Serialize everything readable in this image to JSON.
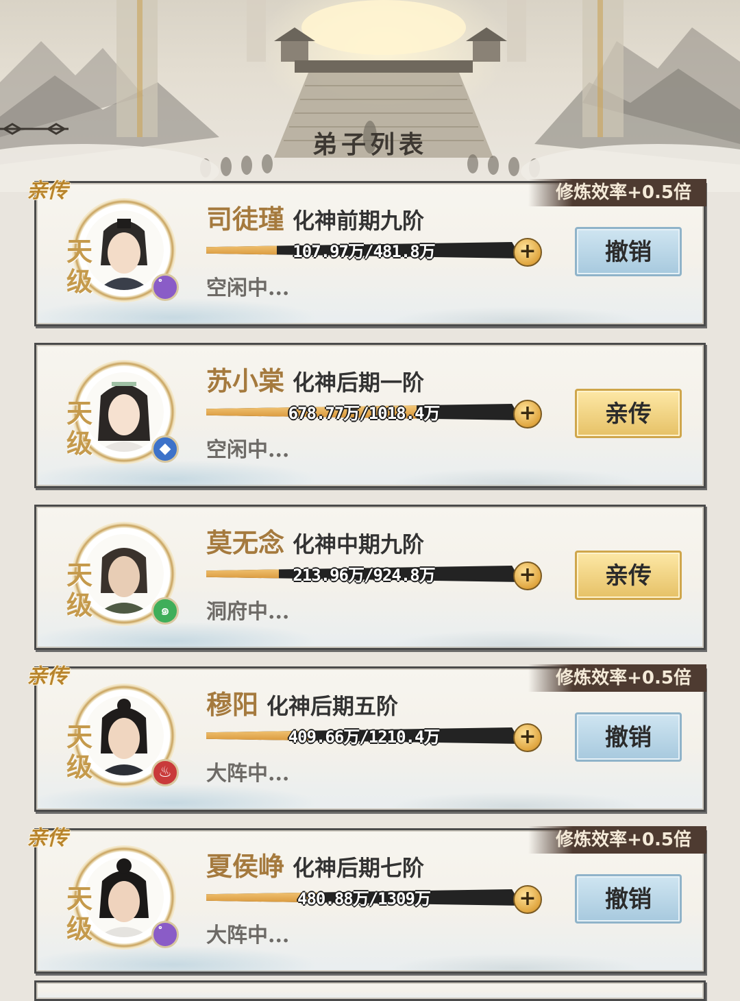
{
  "header": {
    "title": "弟子列表"
  },
  "disciples": [
    {
      "tag": "亲传",
      "bonus": "修炼效率+0.5倍",
      "tier": "天级",
      "element_icon": "spiral-icon",
      "element_color": "#8a5cc7",
      "name": "司徒瑾",
      "realm": "化神前期九阶",
      "progress_text": "107.97万/481.8万",
      "progress": 0.224,
      "status": "空闲中...",
      "action": "撤销"
    },
    {
      "tag": "",
      "bonus": "",
      "tier": "天级",
      "element_icon": "crystal-icon",
      "element_color": "#3d72c9",
      "name": "苏小棠",
      "realm": "化神后期一阶",
      "progress_text": "678.77万/1018.4万",
      "progress": 0.667,
      "status": "空闲中...",
      "action": "亲传"
    },
    {
      "tag": "",
      "bonus": "",
      "tier": "天级",
      "element_icon": "wind-icon",
      "element_color": "#3fae5a",
      "name": "莫无念",
      "realm": "化神中期九阶",
      "progress_text": "213.96万/924.8万",
      "progress": 0.231,
      "status": "洞府中...",
      "action": "亲传"
    },
    {
      "tag": "亲传",
      "bonus": "修炼效率+0.5倍",
      "tier": "天级",
      "element_icon": "flame-icon",
      "element_color": "#c93a3a",
      "name": "穆阳",
      "realm": "化神后期五阶",
      "progress_text": "409.66万/1210.4万",
      "progress": 0.338,
      "status": "大阵中...",
      "action": "撤销"
    },
    {
      "tag": "亲传",
      "bonus": "修炼效率+0.5倍",
      "tier": "天级",
      "element_icon": "spiral-icon",
      "element_color": "#8a5cc7",
      "name": "夏侯峥",
      "realm": "化神后期七阶",
      "progress_text": "480.88万/1309万",
      "progress": 0.367,
      "status": "大阵中...",
      "action": "撤销"
    }
  ]
}
